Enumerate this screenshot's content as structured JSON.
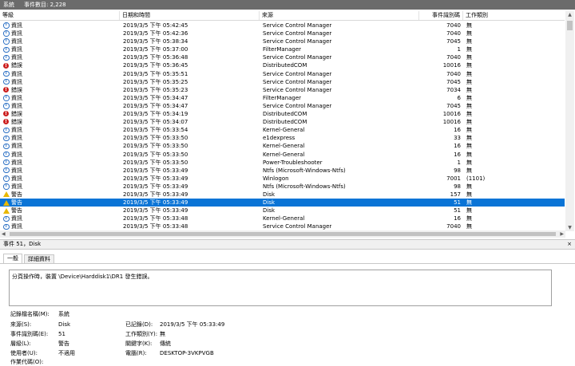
{
  "titlebar": {
    "title": "系統",
    "count": "事件數目: 2,228"
  },
  "columns": {
    "level": "等級",
    "date": "日期和時間",
    "source": "來源",
    "event_id": "事件識別碼",
    "task": "工作類別"
  },
  "rows": [
    {
      "icon": "info",
      "level": "資訊",
      "date": "2019/3/5 下午 05:42:45",
      "source": "Service Control Manager",
      "id": "7040",
      "task": "無"
    },
    {
      "icon": "info",
      "level": "資訊",
      "date": "2019/3/5 下午 05:42:36",
      "source": "Service Control Manager",
      "id": "7040",
      "task": "無"
    },
    {
      "icon": "info",
      "level": "資訊",
      "date": "2019/3/5 下午 05:38:34",
      "source": "Service Control Manager",
      "id": "7045",
      "task": "無"
    },
    {
      "icon": "info",
      "level": "資訊",
      "date": "2019/3/5 下午 05:37:00",
      "source": "FilterManager",
      "id": "1",
      "task": "無"
    },
    {
      "icon": "info",
      "level": "資訊",
      "date": "2019/3/5 下午 05:36:48",
      "source": "Service Control Manager",
      "id": "7040",
      "task": "無"
    },
    {
      "icon": "err",
      "level": "錯誤",
      "date": "2019/3/5 下午 05:36:45",
      "source": "DistributedCOM",
      "id": "10016",
      "task": "無"
    },
    {
      "icon": "info",
      "level": "資訊",
      "date": "2019/3/5 下午 05:35:51",
      "source": "Service Control Manager",
      "id": "7040",
      "task": "無"
    },
    {
      "icon": "info",
      "level": "資訊",
      "date": "2019/3/5 下午 05:35:25",
      "source": "Service Control Manager",
      "id": "7045",
      "task": "無"
    },
    {
      "icon": "err",
      "level": "錯誤",
      "date": "2019/3/5 下午 05:35:23",
      "source": "Service Control Manager",
      "id": "7034",
      "task": "無"
    },
    {
      "icon": "info",
      "level": "資訊",
      "date": "2019/3/5 下午 05:34:47",
      "source": "FilterManager",
      "id": "6",
      "task": "無"
    },
    {
      "icon": "info",
      "level": "資訊",
      "date": "2019/3/5 下午 05:34:47",
      "source": "Service Control Manager",
      "id": "7045",
      "task": "無"
    },
    {
      "icon": "err",
      "level": "錯誤",
      "date": "2019/3/5 下午 05:34:19",
      "source": "DistributedCOM",
      "id": "10016",
      "task": "無"
    },
    {
      "icon": "err",
      "level": "錯誤",
      "date": "2019/3/5 下午 05:34:07",
      "source": "DistributedCOM",
      "id": "10016",
      "task": "無"
    },
    {
      "icon": "info",
      "level": "資訊",
      "date": "2019/3/5 下午 05:33:54",
      "source": "Kernel-General",
      "id": "16",
      "task": "無"
    },
    {
      "icon": "info",
      "level": "資訊",
      "date": "2019/3/5 下午 05:33:50",
      "source": "e1dexpress",
      "id": "33",
      "task": "無"
    },
    {
      "icon": "info",
      "level": "資訊",
      "date": "2019/3/5 下午 05:33:50",
      "source": "Kernel-General",
      "id": "16",
      "task": "無"
    },
    {
      "icon": "info",
      "level": "資訊",
      "date": "2019/3/5 下午 05:33:50",
      "source": "Kernel-General",
      "id": "16",
      "task": "無"
    },
    {
      "icon": "info",
      "level": "資訊",
      "date": "2019/3/5 下午 05:33:50",
      "source": "Power-Troubleshooter",
      "id": "1",
      "task": "無"
    },
    {
      "icon": "info",
      "level": "資訊",
      "date": "2019/3/5 下午 05:33:49",
      "source": "Ntfs (Microsoft-Windows-Ntfs)",
      "id": "98",
      "task": "無"
    },
    {
      "icon": "info",
      "level": "資訊",
      "date": "2019/3/5 下午 05:33:49",
      "source": "Winlogon",
      "id": "7001",
      "task": "(1101)"
    },
    {
      "icon": "info",
      "level": "資訊",
      "date": "2019/3/5 下午 05:33:49",
      "source": "Ntfs (Microsoft-Windows-Ntfs)",
      "id": "98",
      "task": "無"
    },
    {
      "icon": "warn",
      "level": "警告",
      "date": "2019/3/5 下午 05:33:49",
      "source": "Disk",
      "id": "157",
      "task": "無"
    },
    {
      "icon": "warn",
      "level": "警告",
      "date": "2019/3/5 下午 05:33:49",
      "source": "Disk",
      "id": "51",
      "task": "無",
      "selected": true
    },
    {
      "icon": "warn",
      "level": "警告",
      "date": "2019/3/5 下午 05:33:49",
      "source": "Disk",
      "id": "51",
      "task": "無"
    },
    {
      "icon": "info",
      "level": "資訊",
      "date": "2019/3/5 下午 05:33:48",
      "source": "Kernel-General",
      "id": "16",
      "task": "無"
    },
    {
      "icon": "info",
      "level": "資訊",
      "date": "2019/3/5 下午 05:33:48",
      "source": "Service Control Manager",
      "id": "7040",
      "task": "無"
    }
  ],
  "detail": {
    "bar_title": "事件 51，Disk",
    "close": "×",
    "tab_general": "一般",
    "tab_details": "詳細資料",
    "message": "分頁操作時，裝置 \\Device\\Harddisk1\\DR1 發生錯誤。",
    "props": {
      "log_name_label": "記錄檔名稱(M):",
      "log_name": "系統",
      "source_label": "來源(S):",
      "source": "Disk",
      "logged_label": "已記錄(D):",
      "logged": "2019/3/5 下午 05:33:49",
      "event_id_label": "事件識別碼(E):",
      "event_id": "51",
      "task_label": "工作類別(Y):",
      "task": "無",
      "level_label": "層級(L):",
      "level": "警告",
      "keywords_label": "關鍵字(K):",
      "keywords": "傳統",
      "user_label": "使用者(U):",
      "user": "不適用",
      "computer_label": "電腦(R):",
      "computer": "DESKTOP-3VKPVGB",
      "opcode_label": "作業代碼(O):"
    }
  }
}
